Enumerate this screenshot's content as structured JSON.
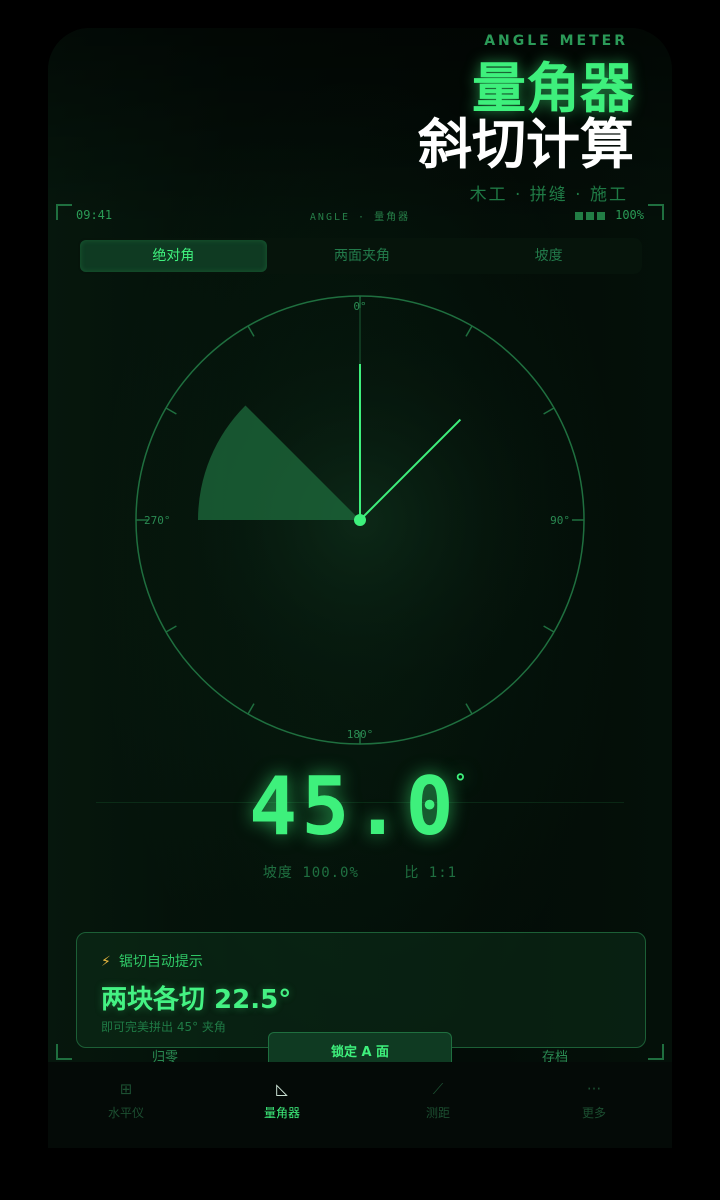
{
  "brand": {
    "en": "ANGLE METER",
    "title": "量角器",
    "subtitle": "斜切计算",
    "tags": "木工 · 拼缝 · 施工"
  },
  "status": {
    "time": "09:41",
    "center": "ANGLE · 量角器",
    "battery": "100%"
  },
  "tabs": [
    {
      "label": "绝对角",
      "active": true
    },
    {
      "label": "两面夹角",
      "active": false
    },
    {
      "label": "坡度",
      "active": false
    }
  ],
  "dial": {
    "labels": {
      "top": "0°",
      "right": "90°",
      "bottom": "180°",
      "left": "270°"
    },
    "needle_deg": 45,
    "sector_from_deg": 270,
    "sector_to_deg": 315
  },
  "reading": {
    "value": "45.0",
    "unit": "°"
  },
  "subinfo": {
    "slope": "坡度 100.0%",
    "ratio": "比 1:1"
  },
  "tip": {
    "head": "锯切自动提示",
    "main": "两块各切 22.5°",
    "note": "即可完美拼出 45° 夹角"
  },
  "actions": {
    "left": "归零",
    "mid": "锁定 A 面",
    "right": "存档"
  },
  "nav": [
    {
      "icon": "⊞",
      "label": "水平仪",
      "active": false
    },
    {
      "icon": "◺",
      "label": "量角器",
      "active": true
    },
    {
      "icon": "⟋",
      "label": "测距",
      "active": false
    },
    {
      "icon": "···",
      "label": "更多",
      "active": false
    }
  ],
  "colors": {
    "accent": "#3ef07c",
    "background": "#04100a",
    "warning": "#e8b640"
  }
}
